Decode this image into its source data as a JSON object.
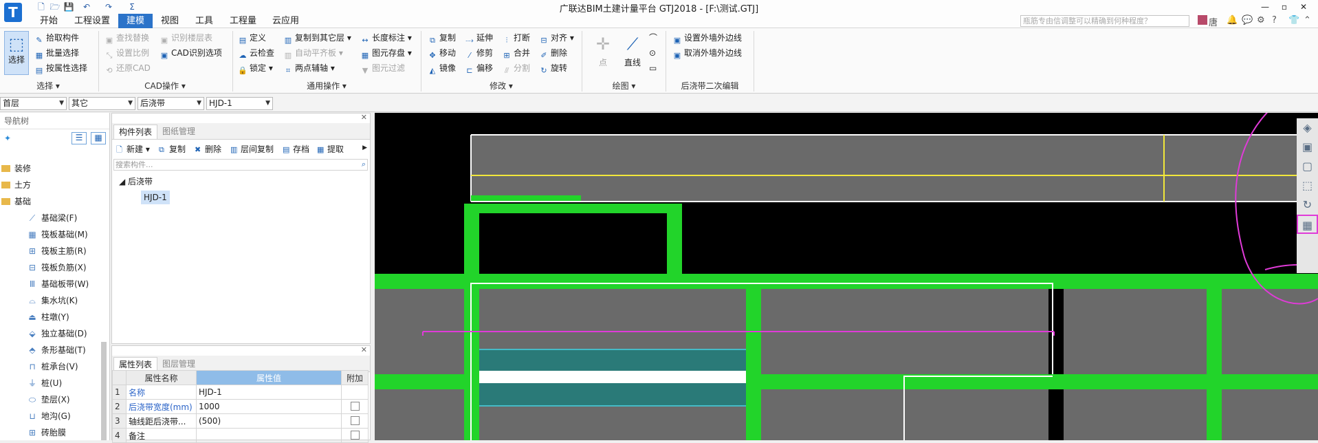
{
  "window": {
    "title": "广联达BIM土建计量平台 GTJ2018 - [F:\\测试.GTJ]",
    "app_logo": "T",
    "controls": [
      "—",
      "▫",
      "✕"
    ]
  },
  "quick_access": [
    "🗋",
    "🗁",
    "💾",
    "↶",
    "↷",
    "Σ"
  ],
  "menu": {
    "items": [
      "开始",
      "工程设置",
      "建模",
      "视图",
      "工具",
      "工程量",
      "云应用"
    ],
    "active_index": 2
  },
  "search": {
    "placeholder": "瓶筋专由信调整可以精确到何种程度？"
  },
  "user": {
    "name": "唐"
  },
  "ribbon": {
    "select_group": {
      "big_button": "选择",
      "items": [
        "拾取构件",
        "批量选择",
        "按属性选择"
      ],
      "label": "选择"
    },
    "cad_group": {
      "items": [
        "查找替换",
        "识别楼层表",
        "设置比例",
        "CAD识别选项",
        "还原CAD"
      ],
      "label": "CAD操作"
    },
    "general_group": {
      "items": [
        "定义",
        "复制到其它层",
        "长度标注",
        "云检查",
        "自动平齐板",
        "图元存盘",
        "锁定",
        "两点辅轴",
        "图元过滤"
      ],
      "label": "通用操作"
    },
    "modify_group": {
      "items": [
        "复制",
        "延伸",
        "打断",
        "对齐",
        "移动",
        "修剪",
        "合并",
        "删除",
        "镜像",
        "偏移",
        "分割",
        "旋转"
      ],
      "label": "修改"
    },
    "draw_group": {
      "items": [
        "点",
        "直线"
      ],
      "label": "绘图"
    },
    "postpour_group": {
      "items": [
        "设置外墙外边线",
        "取消外墙外边线"
      ],
      "label": "后浇带二次编辑"
    }
  },
  "filters": {
    "floor": "首层",
    "category": "其它",
    "type": "后浇带",
    "component": "HJD-1"
  },
  "nav_tree": {
    "title": "导航树",
    "folders": [
      "装修",
      "土方",
      "基础"
    ],
    "children": [
      {
        "label": "基础梁(F)",
        "icon": "beam-icon"
      },
      {
        "label": "筏板基础(M)",
        "icon": "raft-icon"
      },
      {
        "label": "筏板主筋(R)",
        "icon": "rebar-icon"
      },
      {
        "label": "筏板负筋(X)",
        "icon": "neg-rebar-icon"
      },
      {
        "label": "基础板带(W)",
        "icon": "slab-band-icon"
      },
      {
        "label": "集水坑(K)",
        "icon": "sump-icon"
      },
      {
        "label": "柱墩(Y)",
        "icon": "column-pier-icon"
      },
      {
        "label": "独立基础(D)",
        "icon": "isolated-footing-icon"
      },
      {
        "label": "条形基础(T)",
        "icon": "strip-footing-icon"
      },
      {
        "label": "桩承台(V)",
        "icon": "pile-cap-icon"
      },
      {
        "label": "桩(U)",
        "icon": "pile-icon"
      },
      {
        "label": "垫层(X)",
        "icon": "cushion-icon"
      },
      {
        "label": "地沟(G)",
        "icon": "trench-icon"
      },
      {
        "label": "砖胎膜",
        "icon": "brick-mold-icon"
      }
    ]
  },
  "component_panel": {
    "tabs": [
      "构件列表",
      "图纸管理"
    ],
    "tools": [
      "新建",
      "复制",
      "删除",
      "层间复制",
      "存档",
      "提取"
    ],
    "filter_placeholder": "搜索构件...",
    "tree_root": "后浇带",
    "selected": "HJD-1"
  },
  "property_panel": {
    "tabs": [
      "属性列表",
      "图层管理"
    ],
    "headers": [
      "属性名称",
      "属性值",
      "附加"
    ],
    "rows": [
      {
        "no": "1",
        "name": "名称",
        "value": "HJD-1",
        "check": false
      },
      {
        "no": "2",
        "name": "后浇带宽度(mm)",
        "value": "1000",
        "check": true
      },
      {
        "no": "3",
        "name": "轴线距后浇带...",
        "value": "(500)",
        "check": true
      },
      {
        "no": "4",
        "name": "备注",
        "value": "",
        "check": true
      }
    ]
  },
  "colors": {
    "accent": "#2b73c9",
    "canvas_bg": "#000000",
    "wall_green": "#22d42a",
    "slab_gray": "#6a6a6a",
    "highlight_yellow": "#f2e83a",
    "annotation_magenta": "#e03bd8",
    "cyan_band": "#2a7a78"
  }
}
